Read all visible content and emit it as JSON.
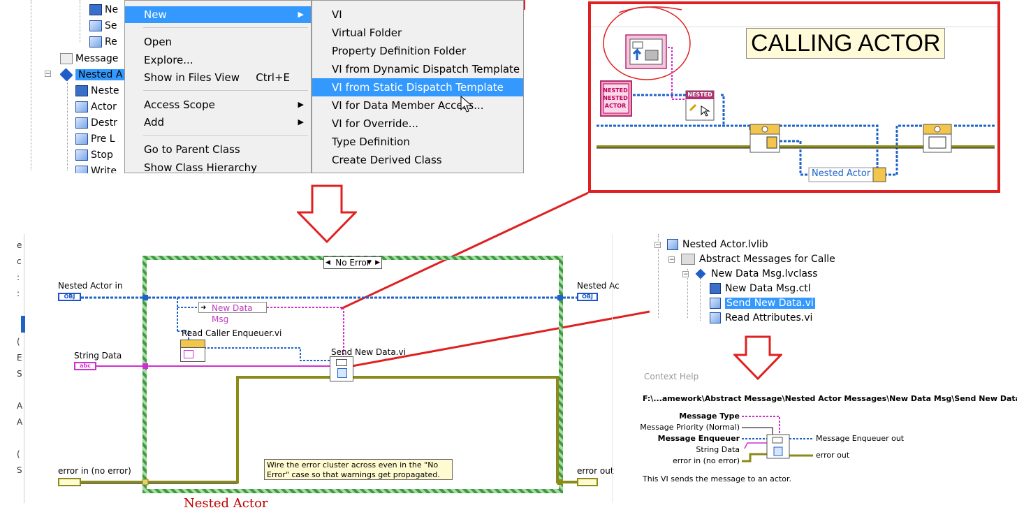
{
  "project_tree_top": {
    "items": [
      {
        "label": "Ne"
      },
      {
        "label": "Se"
      },
      {
        "label": "Re"
      },
      {
        "label": "Message"
      },
      {
        "label": "Nested A"
      },
      {
        "label": "Neste"
      },
      {
        "label": "Actor"
      },
      {
        "label": "Destr"
      },
      {
        "label": "Pre L"
      },
      {
        "label": "Stop"
      },
      {
        "label": "Write"
      }
    ]
  },
  "context_menu": {
    "items": [
      {
        "label": "New",
        "submenu": true,
        "highlighted": true
      },
      {
        "label": "Open"
      },
      {
        "label": "Explore..."
      },
      {
        "label": "Show in Files View",
        "shortcut": "Ctrl+E"
      },
      {
        "label": "Access Scope",
        "submenu": true
      },
      {
        "label": "Add",
        "submenu": true
      },
      {
        "label": "Go to Parent Class"
      },
      {
        "label": "Show Class Hierarchy"
      }
    ]
  },
  "submenu": {
    "items": [
      {
        "label": "VI"
      },
      {
        "label": "Virtual Folder"
      },
      {
        "label": "Property Definition Folder"
      },
      {
        "label": "VI from Dynamic Dispatch Template"
      },
      {
        "label": "VI from Static Dispatch Template",
        "highlighted": true
      },
      {
        "label": "VI for Data Member Access..."
      },
      {
        "label": "VI for Override..."
      },
      {
        "label": "Type Definition"
      },
      {
        "label": "Create Derived Class"
      }
    ]
  },
  "calling_actor": {
    "title": "CALLING ACTOR",
    "nested_label_1": "NESTED",
    "nested_label_2": "NESTED",
    "nested_label_3": "ACTOR",
    "nested_label_small": "NESTED",
    "nested_actor_indicator": "Nested Actor"
  },
  "block_diagram": {
    "case_selector": "No Error",
    "inputs": {
      "nested_actor_in": "Nested Actor in",
      "string_data": "String Data",
      "error_in": "error in (no error)"
    },
    "outputs": {
      "nested_actor_out": "Nested Ac",
      "error_out": "error out"
    },
    "obj_tag": "OBJ",
    "abc_tag": "abc",
    "message_constant": "New Data Msg",
    "read_caller_label": "Read Caller Enqueuer.vi",
    "send_new_data_label": "Send New Data.vi",
    "comment": "Wire the error cluster across even in the \"No Error\" case so that warnings get propagated.",
    "caption": "Nested Actor"
  },
  "project_tree_right": {
    "items": [
      {
        "label": "Nested Actor.lvlib"
      },
      {
        "label": "Abstract Messages for Calle"
      },
      {
        "label": "New Data Msg.lvclass"
      },
      {
        "label": "New Data Msg.ctl"
      },
      {
        "label": "Send New Data.vi",
        "selected": true
      },
      {
        "label": "Read Attributes.vi"
      }
    ]
  },
  "context_help": {
    "title": "Context Help",
    "path": "F:\\...amework\\Abstract Message\\Nested Actor Messages\\New Data Msg\\Send New Data.vi",
    "terminals_left": [
      {
        "label": "Message Type",
        "bold": true
      },
      {
        "label": "Message Priority (Normal)",
        "bold": false
      },
      {
        "label": "Message Enqueuer",
        "bold": true
      },
      {
        "label": "String Data",
        "bold": false
      },
      {
        "label": "error in (no error)",
        "bold": false
      }
    ],
    "terminals_right": [
      {
        "label": "Message Enqueuer out"
      },
      {
        "label": "error out"
      }
    ],
    "description": "This VI sends the message to an actor."
  },
  "colors": {
    "highlight": "#3399ff",
    "annotation_red": "#e02020",
    "case_green": "#3c9d3c",
    "wire_blue": "#1e63c9",
    "wire_pink": "#d02fd0",
    "wire_error": "#7a7a10"
  }
}
